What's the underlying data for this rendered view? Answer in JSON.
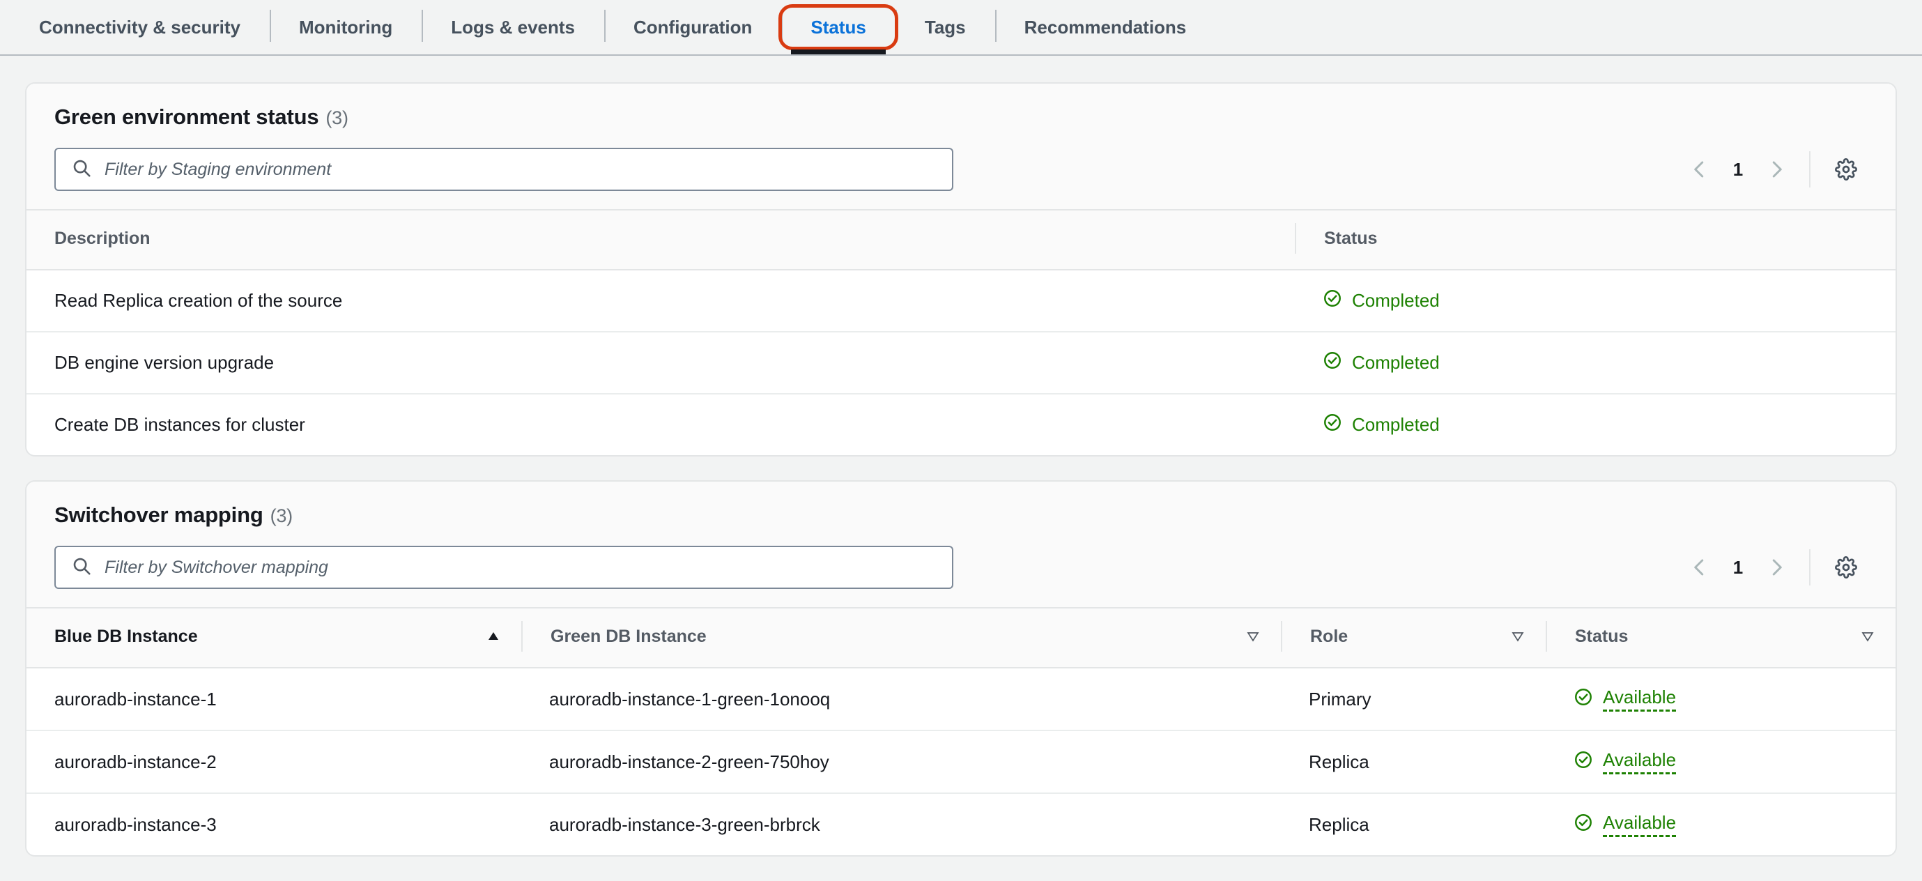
{
  "tabs": [
    {
      "label": "Connectivity & security",
      "active": false
    },
    {
      "label": "Monitoring",
      "active": false
    },
    {
      "label": "Logs & events",
      "active": false
    },
    {
      "label": "Configuration",
      "active": false
    },
    {
      "label": "Status",
      "active": true
    },
    {
      "label": "Tags",
      "active": false
    },
    {
      "label": "Recommendations",
      "active": false
    }
  ],
  "colors": {
    "accent_link": "#0b72d9",
    "highlight_border": "#d93b11",
    "status_green": "#1d8102",
    "text_primary": "#16191f",
    "text_secondary": "#545b64"
  },
  "green_environment_status": {
    "title": "Green environment status",
    "count": "(3)",
    "search": {
      "placeholder": "Filter by Staging environment",
      "value": "",
      "icon": "search-icon"
    },
    "pagination": {
      "prev_icon": "chevron-left-icon",
      "page": "1",
      "next_icon": "chevron-right-icon"
    },
    "settings_icon": "gear-icon",
    "columns": [
      {
        "label": "Description",
        "sort": "none"
      },
      {
        "label": "Status",
        "sort": "none"
      }
    ],
    "rows": [
      {
        "description": "Read Replica creation of the source",
        "status": "Completed",
        "status_icon": "check-circle-icon"
      },
      {
        "description": "DB engine version upgrade",
        "status": "Completed",
        "status_icon": "check-circle-icon"
      },
      {
        "description": "Create DB instances for cluster",
        "status": "Completed",
        "status_icon": "check-circle-icon"
      }
    ]
  },
  "switchover_mapping": {
    "title": "Switchover mapping",
    "count": "(3)",
    "search": {
      "placeholder": "Filter by Switchover mapping",
      "value": "",
      "icon": "search-icon"
    },
    "pagination": {
      "prev_icon": "chevron-left-icon",
      "page": "1",
      "next_icon": "chevron-right-icon"
    },
    "settings_icon": "gear-icon",
    "columns": [
      {
        "label": "Blue DB Instance",
        "sort": "asc"
      },
      {
        "label": "Green DB Instance",
        "sort": "none"
      },
      {
        "label": "Role",
        "sort": "none"
      },
      {
        "label": "Status",
        "sort": "none"
      }
    ],
    "rows": [
      {
        "blue": "auroradb-instance-1",
        "green": "auroradb-instance-1-green-1onooq",
        "role": "Primary",
        "status": "Available",
        "status_icon": "check-circle-icon"
      },
      {
        "blue": "auroradb-instance-2",
        "green": "auroradb-instance-2-green-750hoy",
        "role": "Replica",
        "status": "Available",
        "status_icon": "check-circle-icon"
      },
      {
        "blue": "auroradb-instance-3",
        "green": "auroradb-instance-3-green-brbrck",
        "role": "Replica",
        "status": "Available",
        "status_icon": "check-circle-icon"
      }
    ]
  }
}
